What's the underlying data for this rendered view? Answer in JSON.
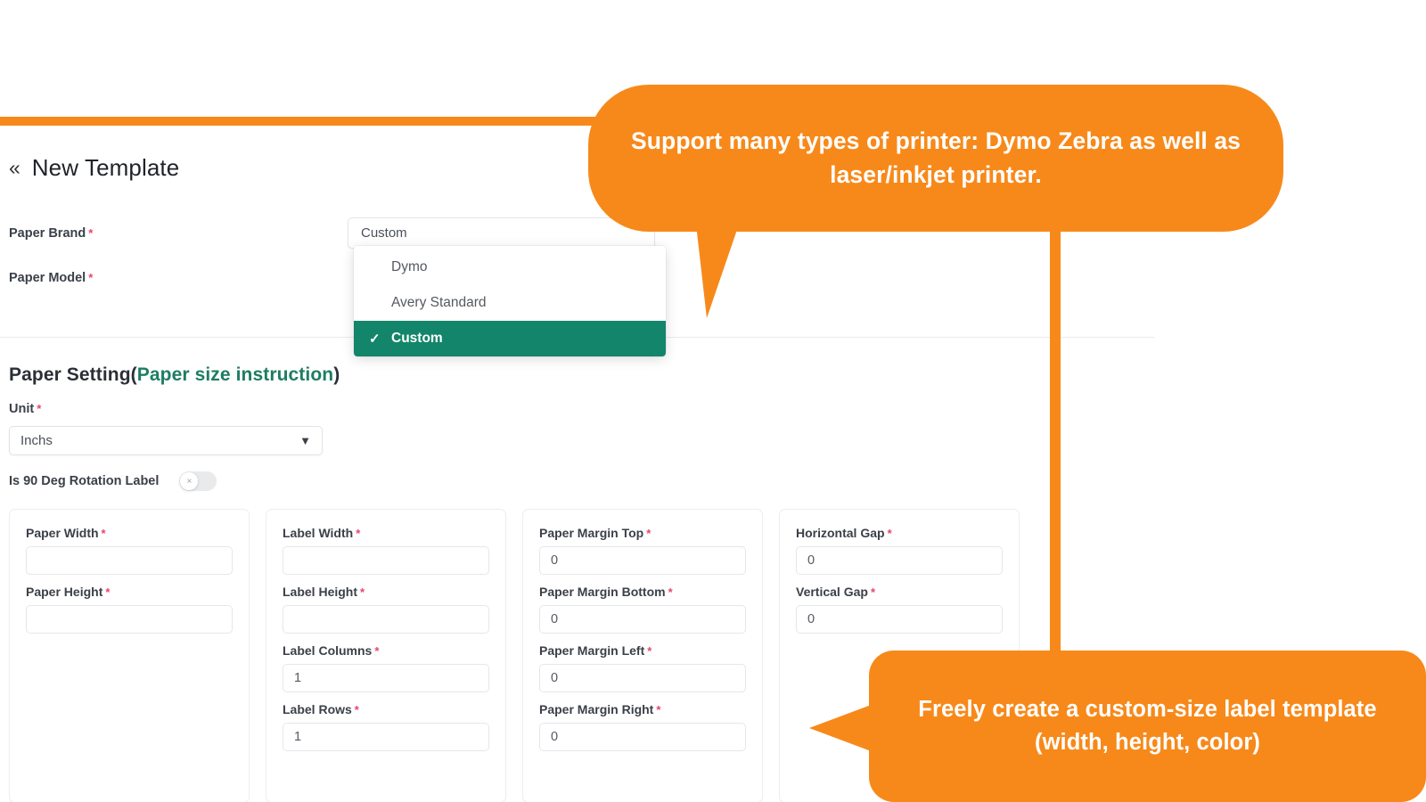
{
  "header": {
    "back_icon": "double-chevron-left-icon",
    "title": "New Template"
  },
  "form": {
    "paper_brand": {
      "label": "Paper Brand",
      "required_mark": "*",
      "value": "Custom"
    },
    "paper_model": {
      "label": "Paper Model",
      "required_mark": "*"
    },
    "brand_dropdown": {
      "options": [
        {
          "label": "Dymo",
          "selected": false
        },
        {
          "label": "Avery Standard",
          "selected": false
        },
        {
          "label": "Custom",
          "selected": true
        }
      ],
      "check_icon": "check-icon"
    }
  },
  "paper_setting": {
    "heading_main": "Paper Setting(",
    "heading_link": "Paper size instruction",
    "heading_close": ")",
    "unit": {
      "label": "Unit",
      "required_mark": "*",
      "value": "Inchs",
      "caret_icon": "chevron-down-icon"
    },
    "rotation": {
      "label": "Is 90 Deg Rotation Label",
      "state": "off",
      "knob_glyph": "×"
    }
  },
  "cards": [
    {
      "name": "paper-size-card",
      "fields": [
        {
          "label": "Paper Width",
          "required_mark": "*",
          "value": ""
        },
        {
          "label": "Paper Height",
          "required_mark": "*",
          "value": ""
        }
      ]
    },
    {
      "name": "label-size-card",
      "fields": [
        {
          "label": "Label Width",
          "required_mark": "*",
          "value": ""
        },
        {
          "label": "Label Height",
          "required_mark": "*",
          "value": ""
        },
        {
          "label": "Label Columns",
          "required_mark": "*",
          "value": "1"
        },
        {
          "label": "Label Rows",
          "required_mark": "*",
          "value": "1"
        }
      ]
    },
    {
      "name": "paper-margin-card",
      "fields": [
        {
          "label": "Paper Margin Top",
          "required_mark": "*",
          "value": "0"
        },
        {
          "label": "Paper Margin Bottom",
          "required_mark": "*",
          "value": "0"
        },
        {
          "label": "Paper Margin Left",
          "required_mark": "*",
          "value": "0"
        },
        {
          "label": "Paper Margin Right",
          "required_mark": "*",
          "value": "0"
        }
      ]
    },
    {
      "name": "gap-card",
      "fields": [
        {
          "label": "Horizontal Gap",
          "required_mark": "*",
          "value": "0"
        },
        {
          "label": "Vertical Gap",
          "required_mark": "*",
          "value": "0"
        }
      ]
    }
  ],
  "scroll_top": {
    "icon": "arrow-up-icon",
    "glyph": "↑"
  },
  "callouts": {
    "top": "Support many types of printer: Dymo Zebra as well as laser/inkjet printer.",
    "bottom": "Freely create a custom-size label template (width, height, color)"
  },
  "colors": {
    "accent_orange": "#f7891a",
    "selected_green": "#13856a",
    "required_pink": "#e8456b",
    "link_green": "#1d7d63"
  }
}
